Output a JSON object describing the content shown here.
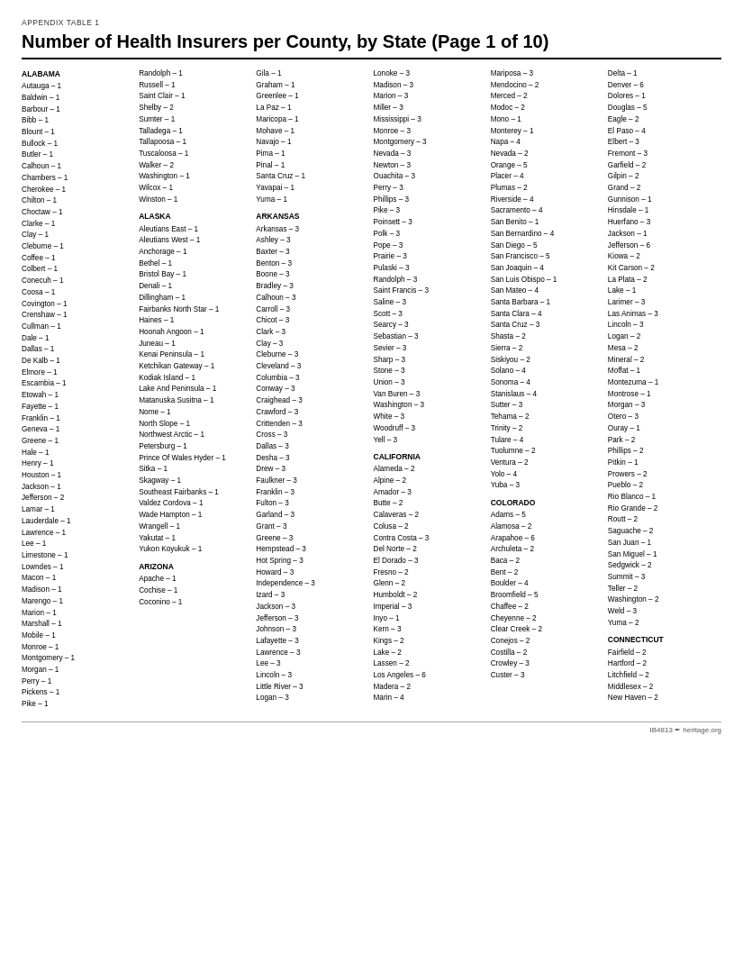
{
  "appendix_label": "APPENDIX TABLE 1",
  "title": "Number of Health Insurers per County, by State (Page 1 of 10)",
  "footer": "IB4813 ✒ heritage.org",
  "columns": [
    {
      "states": [
        {
          "name": "ALABAMA",
          "entries": [
            "Autauga – 1",
            "Baldwin – 1",
            "Barbour – 1",
            "Bibb – 1",
            "Blount – 1",
            "Bullock – 1",
            "Butler – 1",
            "Calhoun – 1",
            "Chambers – 1",
            "Cherokee – 1",
            "Chilton – 1",
            "Choctaw – 1",
            "Clarke – 1",
            "Clay – 1",
            "Cleburne – 1",
            "Coffee – 1",
            "Colbert – 1",
            "Conecuh – 1",
            "Coosa – 1",
            "Covington – 1",
            "Crenshaw – 1",
            "Cullman – 1",
            "Dale – 1",
            "Dallas – 1",
            "De Kalb – 1",
            "Elmore – 1",
            "Escambia – 1",
            "Etowah – 1",
            "Fayette – 1",
            "Franklin – 1",
            "Geneva – 1",
            "Greene – 1",
            "Hale – 1",
            "Henry – 1",
            "Houston – 1",
            "Jackson – 1",
            "Jefferson – 2",
            "Lamar – 1",
            "Lauderdale – 1",
            "Lawrence – 1",
            "Lee – 1",
            "Limestone – 1",
            "Lowndes – 1",
            "Macon – 1",
            "Madison – 1",
            "Marengo – 1",
            "Marion – 1",
            "Marshall – 1",
            "Mobile – 1",
            "Monroe – 1",
            "Montgomery – 1",
            "Morgan – 1",
            "Perry – 1",
            "Pickens – 1",
            "Pike – 1"
          ]
        }
      ]
    },
    {
      "states": [
        {
          "name": "",
          "entries": [
            "Randolph – 1",
            "Russell – 1",
            "Saint Clair – 1",
            "Shelby – 2",
            "Sumter – 1",
            "Talladega – 1",
            "Tallapoosa – 1",
            "Tuscaloosa – 1",
            "Walker – 2",
            "Washington – 1",
            "Wilcox – 1",
            "Winston – 1"
          ]
        },
        {
          "name": "ALASKA",
          "entries": [
            "Aleutians East – 1",
            "Aleutians West – 1",
            "Anchorage – 1",
            "Bethel – 1",
            "Bristol Bay – 1",
            "Denali – 1",
            "Dillingham – 1",
            "Fairbanks North Star – 1",
            "Haines – 1",
            "Hoonah Angoon – 1",
            "Juneau – 1",
            "Kenai Peninsula – 1",
            "Ketchikan Gateway – 1",
            "Kodiak Island – 1",
            "Lake And Peninsula – 1",
            "Matanuska Susitna – 1",
            "Nome – 1",
            "North Slope – 1",
            "Northwest Arctic – 1",
            "Petersburg – 1",
            "Prince Of Wales Hyder – 1",
            "Sitka – 1",
            "Skagway – 1",
            "Southeast Fairbanks – 1",
            "Valdez Cordova – 1",
            "Wade Hampton – 1",
            "Wrangell – 1",
            "Yakutat – 1",
            "Yukon Koyukuk – 1"
          ]
        },
        {
          "name": "ARIZONA",
          "entries": [
            "Apache – 1",
            "Cochise – 1",
            "Coconino – 1"
          ]
        }
      ]
    },
    {
      "states": [
        {
          "name": "",
          "entries": [
            "Gila – 1",
            "Graham – 1",
            "Greenlee – 1",
            "La Paz – 1",
            "Maricopa – 1",
            "Mohave – 1",
            "Navajo – 1",
            "Pima – 1",
            "Pinal – 1",
            "Santa Cruz – 1",
            "Yavapai – 1",
            "Yuma – 1"
          ]
        },
        {
          "name": "ARKANSAS",
          "entries": [
            "Arkansas – 3",
            "Ashley – 3",
            "Baxter – 3",
            "Benton – 3",
            "Boone – 3",
            "Bradley – 3",
            "Calhoun – 3",
            "Carroll – 3",
            "Chicot – 3",
            "Clark – 3",
            "Clay – 3",
            "Cleburne – 3",
            "Cleveland – 3",
            "Columbia – 3",
            "Conway – 3",
            "Craighead – 3",
            "Crawford – 3",
            "Crittenden – 3",
            "Cross – 3",
            "Dallas – 3",
            "Desha – 3",
            "Drew – 3",
            "Faulkner – 3",
            "Franklin – 3",
            "Fulton – 3",
            "Garland – 3",
            "Grant – 3",
            "Greene – 3",
            "Hempstead – 3",
            "Hot Spring – 3",
            "Howard – 3",
            "Independence – 3",
            "Izard – 3",
            "Jackson – 3",
            "Jefferson – 3",
            "Johnson – 3",
            "Lafayette – 3",
            "Lawrence – 3",
            "Lee – 3",
            "Lincoln – 3",
            "Little River – 3",
            "Logan – 3"
          ]
        }
      ]
    },
    {
      "states": [
        {
          "name": "",
          "entries": [
            "Lonoke – 3",
            "Madison – 3",
            "Marion – 3",
            "Miller – 3",
            "Mississippi – 3",
            "Monroe – 3",
            "Montgomery – 3",
            "Nevada – 3",
            "Newton – 3",
            "Ouachita – 3",
            "Perry – 3",
            "Phillips – 3",
            "Pike – 3",
            "Poinsett – 3",
            "Polk – 3",
            "Pope – 3",
            "Prairie – 3",
            "Pulaski – 3",
            "Randolph – 3",
            "Saint Francis – 3",
            "Saline – 3",
            "Scott – 3",
            "Searcy – 3",
            "Sebastian – 3",
            "Sevier – 3",
            "Sharp – 3",
            "Stone – 3",
            "Union – 3",
            "Van Buren – 3",
            "Washington – 3",
            "White – 3",
            "Woodruff – 3",
            "Yell – 3"
          ]
        },
        {
          "name": "CALIFORNIA",
          "entries": [
            "Alameda – 2",
            "Alpine – 2",
            "Amador – 3",
            "Butte – 2",
            "Calaveras – 2",
            "Colusa – 2",
            "Contra Costa – 3",
            "Del Norte – 2",
            "El Dorado – 3",
            "Fresno – 2",
            "Glenn – 2",
            "Humboldt – 2",
            "Imperial – 3",
            "Inyo – 1",
            "Kern – 3",
            "Kings – 2",
            "Lake – 2",
            "Lassen – 2",
            "Los Angeles – 6",
            "Madera – 2",
            "Marin – 4"
          ]
        }
      ]
    },
    {
      "states": [
        {
          "name": "",
          "entries": [
            "Mariposa – 3",
            "Mendocino – 2",
            "Merced – 2",
            "Modoc – 2",
            "Mono – 1",
            "Monterey – 1",
            "Napa – 4",
            "Nevada – 2",
            "Orange – 5",
            "Placer – 4",
            "Plumas – 2",
            "Riverside – 4",
            "Sacramento – 4",
            "San Benito – 1",
            "San Bernardino – 4",
            "San Diego – 5",
            "San Francisco – 5",
            "San Joaquin – 4",
            "San Luis Obispo – 1",
            "San Mateo – 4",
            "Santa Barbara – 1",
            "Santa Clara – 4",
            "Santa Cruz – 3",
            "Shasta – 2",
            "Sierra – 2",
            "Siskiyou – 2",
            "Solano – 4",
            "Sonoma – 4",
            "Stanislaus – 4",
            "Sutter – 3",
            "Tehama – 2",
            "Trinity – 2",
            "Tulare – 4",
            "Tuolumne – 2",
            "Ventura – 2",
            "Yolo – 4",
            "Yuba – 3"
          ]
        },
        {
          "name": "COLORADO",
          "entries": [
            "Adams – 5",
            "Alamosa – 2",
            "Arapahoe – 6",
            "Archuleta – 2",
            "Baca – 2",
            "Bent – 2",
            "Boulder – 4",
            "Broomfield – 5",
            "Chaffee – 2",
            "Cheyenne – 2",
            "Clear Creek – 2",
            "Conejos – 2",
            "Costilla – 2",
            "Crowley – 3",
            "Custer – 3"
          ]
        }
      ]
    },
    {
      "states": [
        {
          "name": "",
          "entries": [
            "Delta – 1",
            "Denver – 6",
            "Dolores – 1",
            "Douglas – 5",
            "Eagle – 2",
            "El Paso – 4",
            "Elbert – 3",
            "Fremont – 3",
            "Garfield – 2",
            "Gilpin – 2",
            "Grand – 2",
            "Gunnison – 1",
            "Hinsdale – 1",
            "Huerfano – 3",
            "Jackson – 1",
            "Jefferson – 6",
            "Kiowa – 2",
            "Kit Carson – 2",
            "La Plata – 2",
            "Lake – 1",
            "Larimer – 3",
            "Las Animas – 3",
            "Lincoln – 3",
            "Logan – 2",
            "Mesa – 2",
            "Mineral – 2",
            "Moffat – 1",
            "Montezuma – 1",
            "Montrose – 1",
            "Morgan – 3",
            "Otero – 3",
            "Ouray – 1",
            "Park – 2",
            "Phillips – 2",
            "Pitkin – 1",
            "Prowers – 2",
            "Pueblo – 2",
            "Rio Blanco – 1",
            "Rio Grande – 2",
            "Routt – 2",
            "Saguache – 2",
            "San Juan – 1",
            "San Miguel – 1",
            "Sedgwick – 2",
            "Summit – 3",
            "Teller – 2",
            "Washington – 2",
            "Weld – 3",
            "Yuma – 2"
          ]
        },
        {
          "name": "CONNECTICUT",
          "entries": [
            "Fairfield – 2",
            "Hartford – 2",
            "Litchfield – 2",
            "Middlesex – 2",
            "New Haven – 2"
          ]
        }
      ]
    }
  ]
}
